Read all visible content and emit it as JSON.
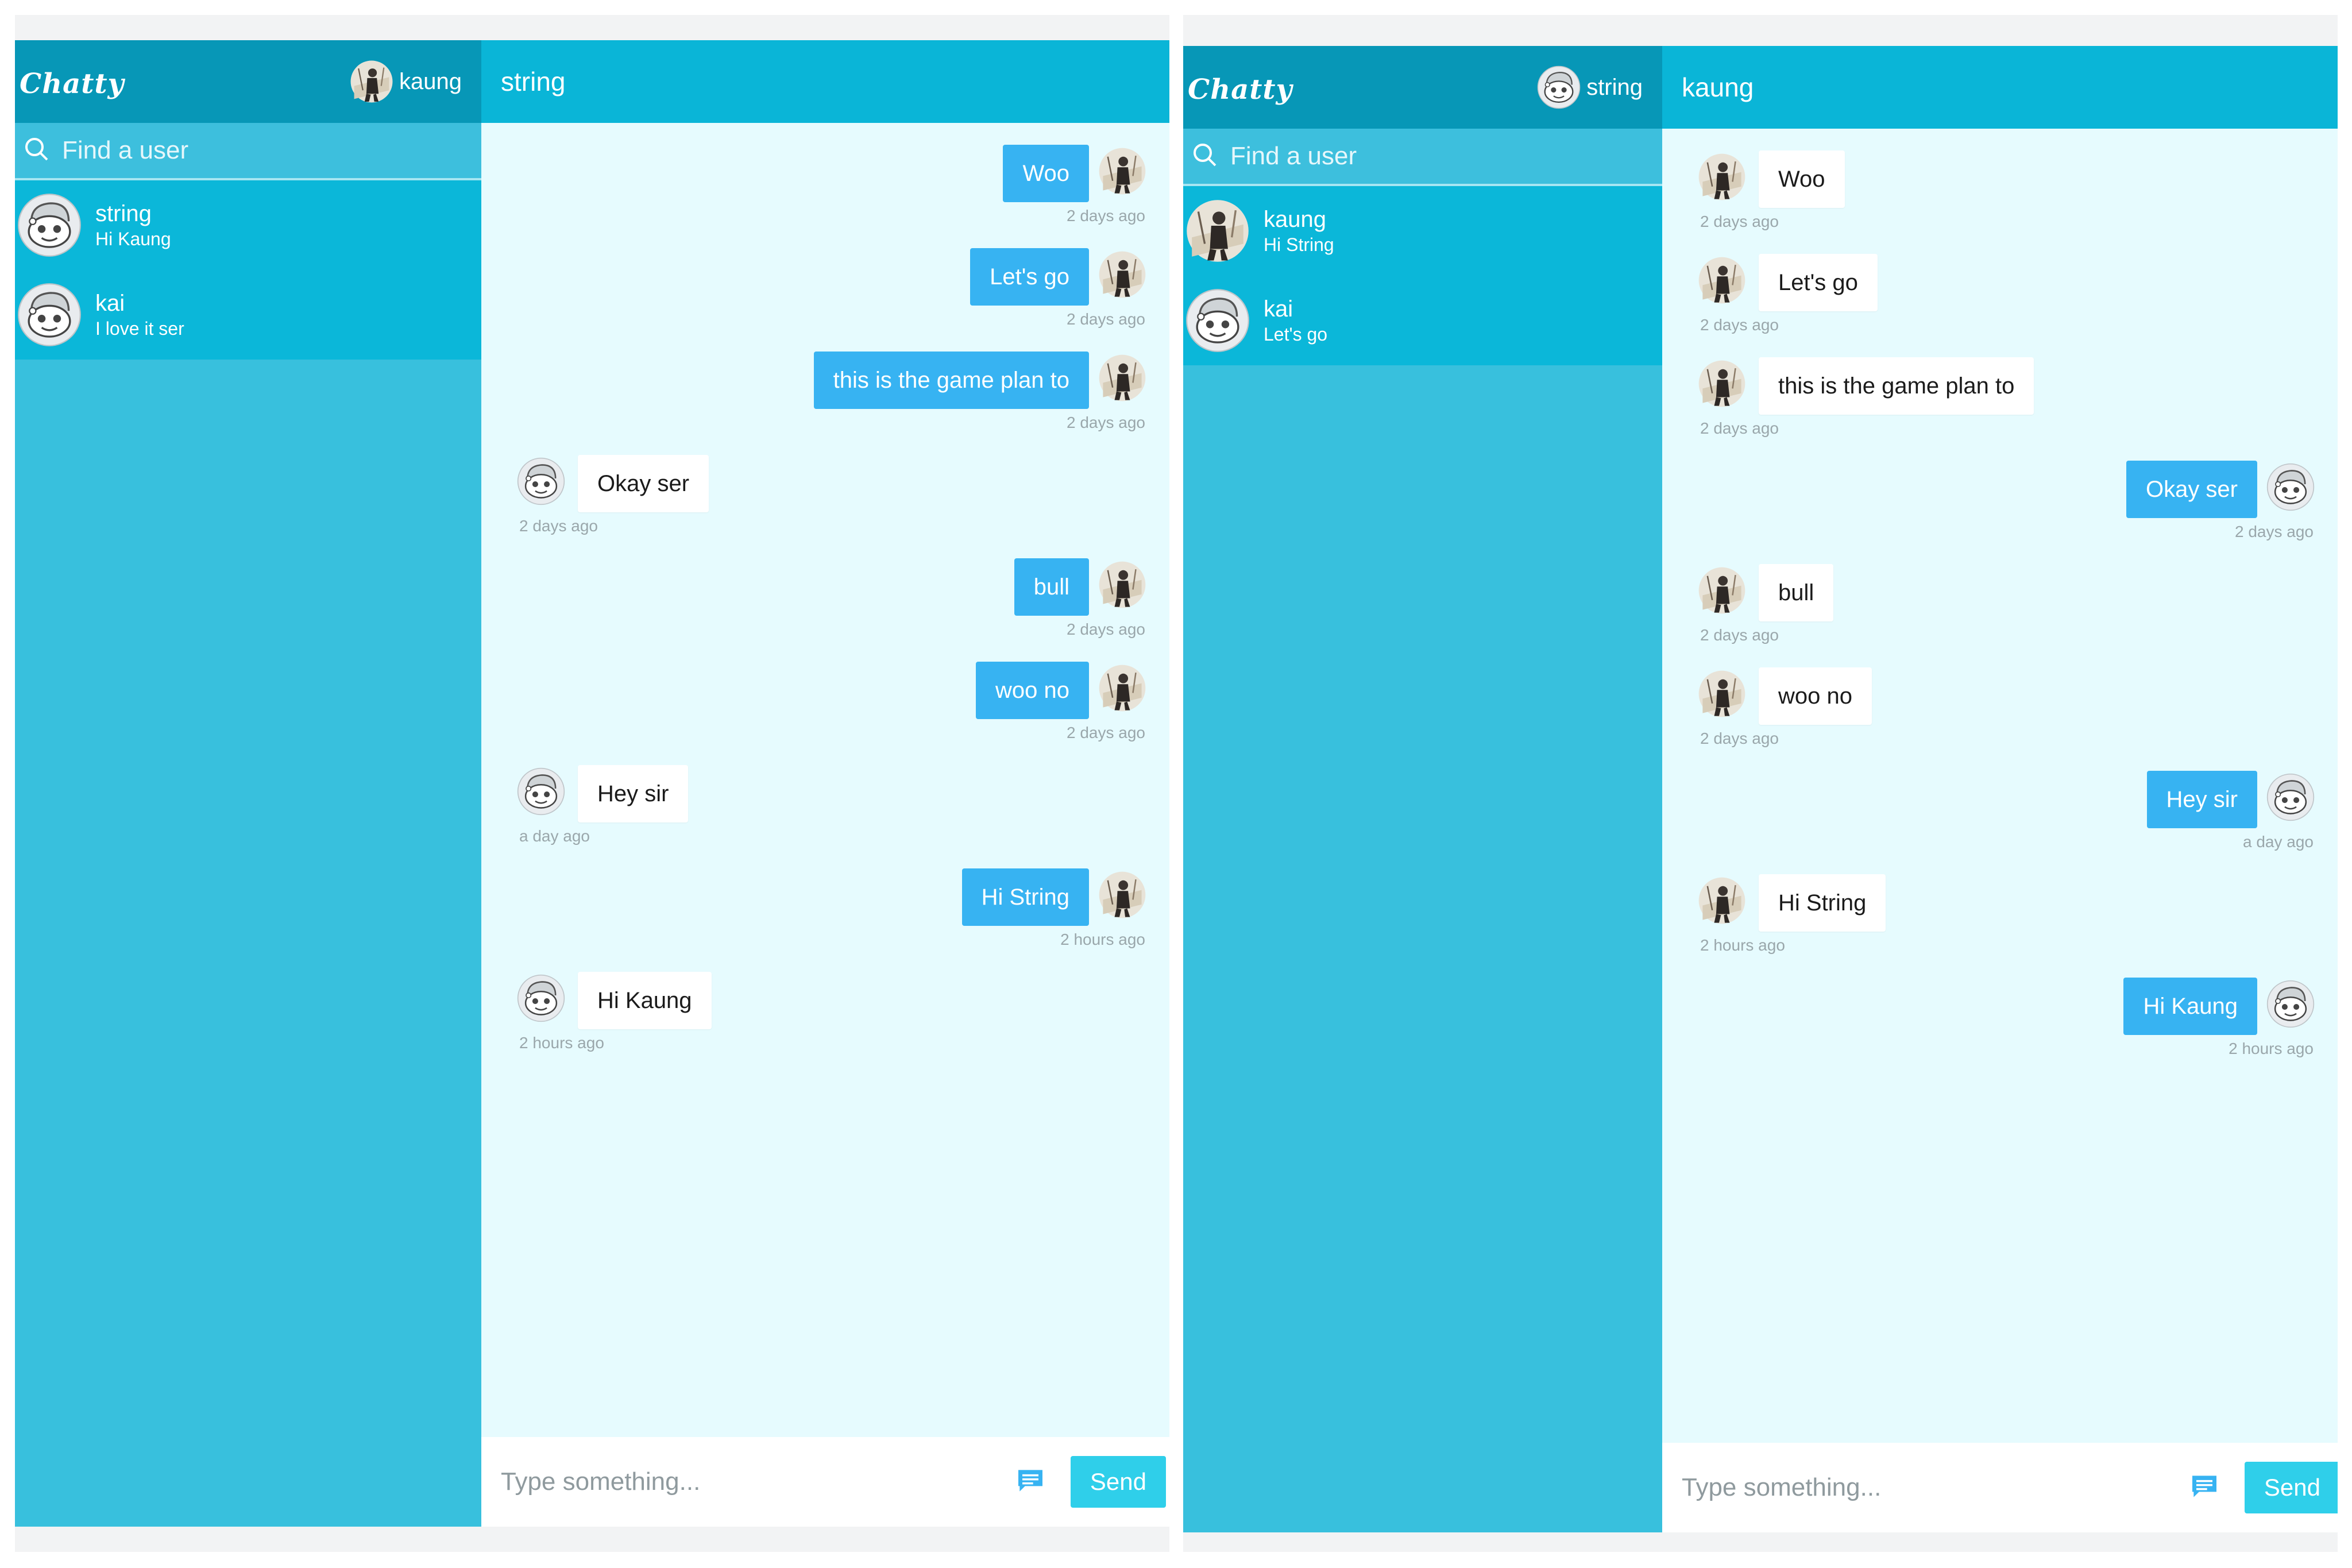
{
  "colors": {
    "sidebar": "#38c0dd",
    "sidebar_header": "#0797b7",
    "user_list": "#0bb7d9",
    "chat_header": "#0ab5d7",
    "chat_bg": "#e6fbfe",
    "bubble_out": "#37b3f2",
    "send_button": "#2fcfea"
  },
  "panels": [
    {
      "logo": "Chatty",
      "current_user": {
        "name": "kaung",
        "avatar": "photo-avatar"
      },
      "search_placeholder": "Find a user",
      "users": [
        {
          "name": "string",
          "last_message": "Hi Kaung",
          "avatar": "robot-avatar"
        },
        {
          "name": "kai",
          "last_message": "I love it ser",
          "avatar": "robot-avatar"
        }
      ],
      "chat_title": "string",
      "messages": [
        {
          "text": "Woo",
          "time": "2 days ago",
          "direction": "out",
          "avatar": "photo-avatar"
        },
        {
          "text": "Let's go",
          "time": "2 days ago",
          "direction": "out",
          "avatar": "photo-avatar"
        },
        {
          "text": "this is the game plan to",
          "time": "2 days ago",
          "direction": "out",
          "avatar": "photo-avatar"
        },
        {
          "text": "Okay ser",
          "time": "2 days ago",
          "direction": "in",
          "avatar": "robot-avatar"
        },
        {
          "text": "bull",
          "time": "2 days ago",
          "direction": "out",
          "avatar": "photo-avatar"
        },
        {
          "text": "woo no",
          "time": "2 days ago",
          "direction": "out",
          "avatar": "photo-avatar"
        },
        {
          "text": "Hey sir",
          "time": "a day ago",
          "direction": "in",
          "avatar": "robot-avatar"
        },
        {
          "text": "Hi String",
          "time": "2 hours ago",
          "direction": "out",
          "avatar": "photo-avatar"
        },
        {
          "text": "Hi Kaung",
          "time": "2 hours ago",
          "direction": "in",
          "avatar": "robot-avatar"
        }
      ],
      "input_placeholder": "Type something...",
      "send_label": "Send"
    },
    {
      "logo": "Chatty",
      "current_user": {
        "name": "string",
        "avatar": "robot-avatar"
      },
      "search_placeholder": "Find a user",
      "users": [
        {
          "name": "kaung",
          "last_message": "Hi String",
          "avatar": "photo-avatar"
        },
        {
          "name": "kai",
          "last_message": "Let's go",
          "avatar": "robot-avatar"
        }
      ],
      "chat_title": "kaung",
      "messages": [
        {
          "text": "Woo",
          "time": "2 days ago",
          "direction": "in",
          "avatar": "photo-avatar"
        },
        {
          "text": "Let's go",
          "time": "2 days ago",
          "direction": "in",
          "avatar": "photo-avatar"
        },
        {
          "text": "this is the game plan to",
          "time": "2 days ago",
          "direction": "in",
          "avatar": "photo-avatar"
        },
        {
          "text": "Okay ser",
          "time": "2 days ago",
          "direction": "out",
          "avatar": "robot-avatar"
        },
        {
          "text": "bull",
          "time": "2 days ago",
          "direction": "in",
          "avatar": "photo-avatar"
        },
        {
          "text": "woo no",
          "time": "2 days ago",
          "direction": "in",
          "avatar": "photo-avatar"
        },
        {
          "text": "Hey sir",
          "time": "a day ago",
          "direction": "out",
          "avatar": "robot-avatar"
        },
        {
          "text": "Hi String",
          "time": "2 hours ago",
          "direction": "in",
          "avatar": "photo-avatar"
        },
        {
          "text": "Hi Kaung",
          "time": "2 hours ago",
          "direction": "out",
          "avatar": "robot-avatar"
        }
      ],
      "input_placeholder": "Type something...",
      "send_label": "Send"
    }
  ]
}
